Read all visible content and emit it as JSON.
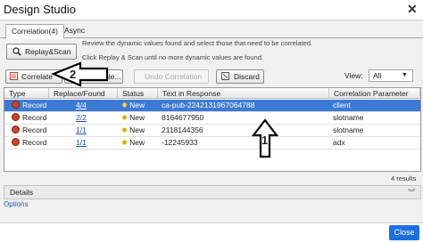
{
  "window": {
    "title": "Design Studio",
    "close_label": "✕"
  },
  "tabs": [
    {
      "label": "Correlation(4)",
      "active": true
    },
    {
      "label": "Async",
      "active": false
    }
  ],
  "toolbar": {
    "replay_label": "Replay&Scan",
    "info_line1": "Review the dynamic values found and select those that need to be correlated.",
    "info_line2": "Click Replay & Scan until no more dynamic values are found.",
    "correlate_label": "Correlate",
    "rule_label": "ule...",
    "undo_label": "Undo Correlation",
    "discard_label": "Discard",
    "view_label": "View:",
    "view_value": "All"
  },
  "table": {
    "headers": [
      "Type",
      "Replace/Found",
      "Status",
      "Text in Response",
      "Correlation Parameter"
    ],
    "rows": [
      {
        "type": "Record",
        "found": "4/4",
        "status": "New",
        "text": "ca-pub-2242131967064788",
        "param": "client",
        "selected": true
      },
      {
        "type": "Record",
        "found": "2/2",
        "status": "New",
        "text": "8164677950",
        "param": "slotname",
        "selected": false
      },
      {
        "type": "Record",
        "found": "1/1",
        "status": "New",
        "text": "2118144356",
        "param": "slotname",
        "selected": false
      },
      {
        "type": "Record",
        "found": "1/1",
        "status": "New",
        "text": "-12245933",
        "param": "adx",
        "selected": false
      }
    ]
  },
  "results_text": "4 results",
  "details": {
    "label": "Details",
    "chevron": "︾"
  },
  "options_label": "Options",
  "close_button_label": "Close",
  "annotations": {
    "arrow1": "1",
    "arrow2": "2"
  }
}
